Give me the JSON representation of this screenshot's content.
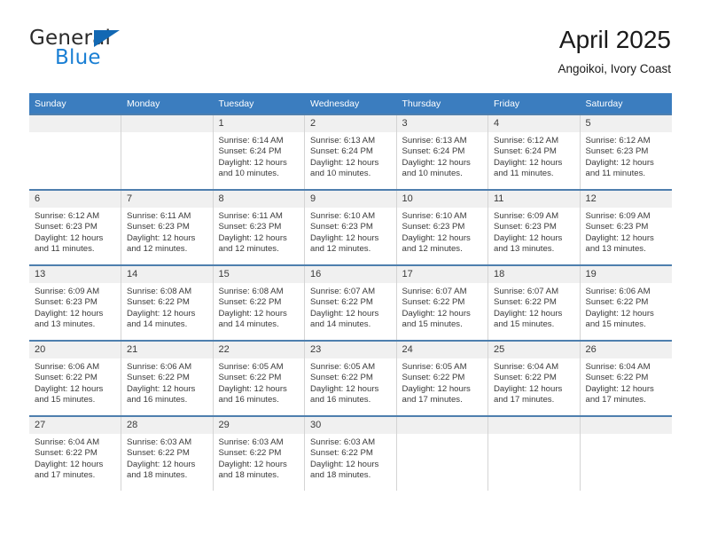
{
  "brand": {
    "name_part1": "General",
    "name_part2": "Blue",
    "primary_color": "#1a7fd4",
    "triangle_color": "#1268b3",
    "triangle_icon": "triangle-icon"
  },
  "header": {
    "title": "April 2025",
    "subtitle": "Angoikoi, Ivory Coast"
  },
  "calendar": {
    "header_bg": "#3b7dbf",
    "header_text_color": "#ffffff",
    "row_border_color": "#4e7fae",
    "daynum_bg": "#f0f0f0",
    "weekday_headers": [
      "Sunday",
      "Monday",
      "Tuesday",
      "Wednesday",
      "Thursday",
      "Friday",
      "Saturday"
    ],
    "weeks": [
      [
        {
          "day": "",
          "sunrise": "",
          "sunset": "",
          "daylight_line1": "",
          "daylight_line2": ""
        },
        {
          "day": "",
          "sunrise": "",
          "sunset": "",
          "daylight_line1": "",
          "daylight_line2": ""
        },
        {
          "day": "1",
          "sunrise": "Sunrise: 6:14 AM",
          "sunset": "Sunset: 6:24 PM",
          "daylight_line1": "Daylight: 12 hours",
          "daylight_line2": "and 10 minutes."
        },
        {
          "day": "2",
          "sunrise": "Sunrise: 6:13 AM",
          "sunset": "Sunset: 6:24 PM",
          "daylight_line1": "Daylight: 12 hours",
          "daylight_line2": "and 10 minutes."
        },
        {
          "day": "3",
          "sunrise": "Sunrise: 6:13 AM",
          "sunset": "Sunset: 6:24 PM",
          "daylight_line1": "Daylight: 12 hours",
          "daylight_line2": "and 10 minutes."
        },
        {
          "day": "4",
          "sunrise": "Sunrise: 6:12 AM",
          "sunset": "Sunset: 6:24 PM",
          "daylight_line1": "Daylight: 12 hours",
          "daylight_line2": "and 11 minutes."
        },
        {
          "day": "5",
          "sunrise": "Sunrise: 6:12 AM",
          "sunset": "Sunset: 6:23 PM",
          "daylight_line1": "Daylight: 12 hours",
          "daylight_line2": "and 11 minutes."
        }
      ],
      [
        {
          "day": "6",
          "sunrise": "Sunrise: 6:12 AM",
          "sunset": "Sunset: 6:23 PM",
          "daylight_line1": "Daylight: 12 hours",
          "daylight_line2": "and 11 minutes."
        },
        {
          "day": "7",
          "sunrise": "Sunrise: 6:11 AM",
          "sunset": "Sunset: 6:23 PM",
          "daylight_line1": "Daylight: 12 hours",
          "daylight_line2": "and 12 minutes."
        },
        {
          "day": "8",
          "sunrise": "Sunrise: 6:11 AM",
          "sunset": "Sunset: 6:23 PM",
          "daylight_line1": "Daylight: 12 hours",
          "daylight_line2": "and 12 minutes."
        },
        {
          "day": "9",
          "sunrise": "Sunrise: 6:10 AM",
          "sunset": "Sunset: 6:23 PM",
          "daylight_line1": "Daylight: 12 hours",
          "daylight_line2": "and 12 minutes."
        },
        {
          "day": "10",
          "sunrise": "Sunrise: 6:10 AM",
          "sunset": "Sunset: 6:23 PM",
          "daylight_line1": "Daylight: 12 hours",
          "daylight_line2": "and 12 minutes."
        },
        {
          "day": "11",
          "sunrise": "Sunrise: 6:09 AM",
          "sunset": "Sunset: 6:23 PM",
          "daylight_line1": "Daylight: 12 hours",
          "daylight_line2": "and 13 minutes."
        },
        {
          "day": "12",
          "sunrise": "Sunrise: 6:09 AM",
          "sunset": "Sunset: 6:23 PM",
          "daylight_line1": "Daylight: 12 hours",
          "daylight_line2": "and 13 minutes."
        }
      ],
      [
        {
          "day": "13",
          "sunrise": "Sunrise: 6:09 AM",
          "sunset": "Sunset: 6:23 PM",
          "daylight_line1": "Daylight: 12 hours",
          "daylight_line2": "and 13 minutes."
        },
        {
          "day": "14",
          "sunrise": "Sunrise: 6:08 AM",
          "sunset": "Sunset: 6:22 PM",
          "daylight_line1": "Daylight: 12 hours",
          "daylight_line2": "and 14 minutes."
        },
        {
          "day": "15",
          "sunrise": "Sunrise: 6:08 AM",
          "sunset": "Sunset: 6:22 PM",
          "daylight_line1": "Daylight: 12 hours",
          "daylight_line2": "and 14 minutes."
        },
        {
          "day": "16",
          "sunrise": "Sunrise: 6:07 AM",
          "sunset": "Sunset: 6:22 PM",
          "daylight_line1": "Daylight: 12 hours",
          "daylight_line2": "and 14 minutes."
        },
        {
          "day": "17",
          "sunrise": "Sunrise: 6:07 AM",
          "sunset": "Sunset: 6:22 PM",
          "daylight_line1": "Daylight: 12 hours",
          "daylight_line2": "and 15 minutes."
        },
        {
          "day": "18",
          "sunrise": "Sunrise: 6:07 AM",
          "sunset": "Sunset: 6:22 PM",
          "daylight_line1": "Daylight: 12 hours",
          "daylight_line2": "and 15 minutes."
        },
        {
          "day": "19",
          "sunrise": "Sunrise: 6:06 AM",
          "sunset": "Sunset: 6:22 PM",
          "daylight_line1": "Daylight: 12 hours",
          "daylight_line2": "and 15 minutes."
        }
      ],
      [
        {
          "day": "20",
          "sunrise": "Sunrise: 6:06 AM",
          "sunset": "Sunset: 6:22 PM",
          "daylight_line1": "Daylight: 12 hours",
          "daylight_line2": "and 15 minutes."
        },
        {
          "day": "21",
          "sunrise": "Sunrise: 6:06 AM",
          "sunset": "Sunset: 6:22 PM",
          "daylight_line1": "Daylight: 12 hours",
          "daylight_line2": "and 16 minutes."
        },
        {
          "day": "22",
          "sunrise": "Sunrise: 6:05 AM",
          "sunset": "Sunset: 6:22 PM",
          "daylight_line1": "Daylight: 12 hours",
          "daylight_line2": "and 16 minutes."
        },
        {
          "day": "23",
          "sunrise": "Sunrise: 6:05 AM",
          "sunset": "Sunset: 6:22 PM",
          "daylight_line1": "Daylight: 12 hours",
          "daylight_line2": "and 16 minutes."
        },
        {
          "day": "24",
          "sunrise": "Sunrise: 6:05 AM",
          "sunset": "Sunset: 6:22 PM",
          "daylight_line1": "Daylight: 12 hours",
          "daylight_line2": "and 17 minutes."
        },
        {
          "day": "25",
          "sunrise": "Sunrise: 6:04 AM",
          "sunset": "Sunset: 6:22 PM",
          "daylight_line1": "Daylight: 12 hours",
          "daylight_line2": "and 17 minutes."
        },
        {
          "day": "26",
          "sunrise": "Sunrise: 6:04 AM",
          "sunset": "Sunset: 6:22 PM",
          "daylight_line1": "Daylight: 12 hours",
          "daylight_line2": "and 17 minutes."
        }
      ],
      [
        {
          "day": "27",
          "sunrise": "Sunrise: 6:04 AM",
          "sunset": "Sunset: 6:22 PM",
          "daylight_line1": "Daylight: 12 hours",
          "daylight_line2": "and 17 minutes."
        },
        {
          "day": "28",
          "sunrise": "Sunrise: 6:03 AM",
          "sunset": "Sunset: 6:22 PM",
          "daylight_line1": "Daylight: 12 hours",
          "daylight_line2": "and 18 minutes."
        },
        {
          "day": "29",
          "sunrise": "Sunrise: 6:03 AM",
          "sunset": "Sunset: 6:22 PM",
          "daylight_line1": "Daylight: 12 hours",
          "daylight_line2": "and 18 minutes."
        },
        {
          "day": "30",
          "sunrise": "Sunrise: 6:03 AM",
          "sunset": "Sunset: 6:22 PM",
          "daylight_line1": "Daylight: 12 hours",
          "daylight_line2": "and 18 minutes."
        },
        {
          "day": "",
          "sunrise": "",
          "sunset": "",
          "daylight_line1": "",
          "daylight_line2": ""
        },
        {
          "day": "",
          "sunrise": "",
          "sunset": "",
          "daylight_line1": "",
          "daylight_line2": ""
        },
        {
          "day": "",
          "sunrise": "",
          "sunset": "",
          "daylight_line1": "",
          "daylight_line2": ""
        }
      ]
    ]
  }
}
